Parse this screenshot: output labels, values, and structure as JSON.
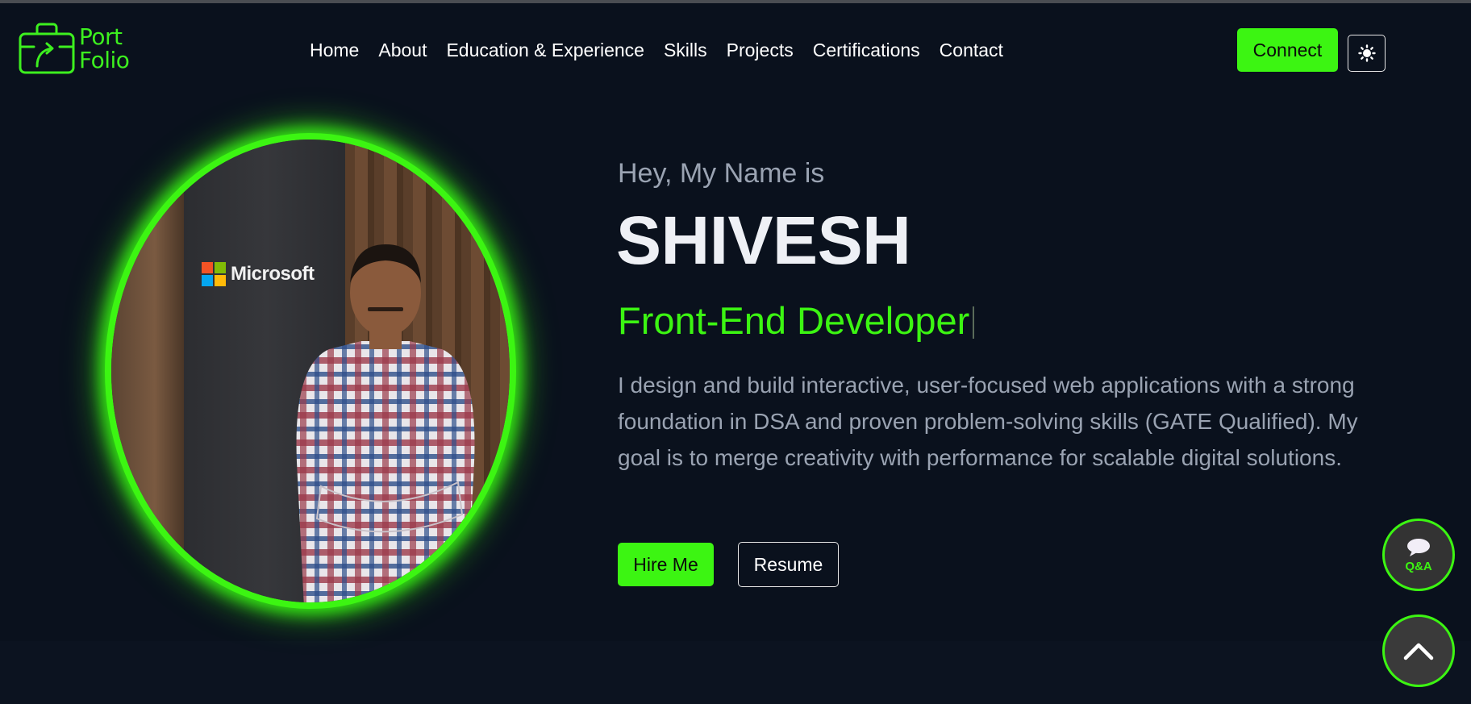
{
  "brand": {
    "logo_line1": "Port",
    "logo_line2": "Folio",
    "accent": "#3cf512"
  },
  "nav": {
    "items": [
      {
        "label": "Home"
      },
      {
        "label": "About"
      },
      {
        "label": "Education & Experience"
      },
      {
        "label": "Skills"
      },
      {
        "label": "Projects"
      },
      {
        "label": "Certifications"
      },
      {
        "label": "Contact"
      }
    ],
    "connect_label": "Connect",
    "theme_icon": "sun-icon"
  },
  "hero": {
    "photo_sign": "Microsoft",
    "greeting": "Hey, My Name is",
    "name": "SHIVESH",
    "role": "Front-End Developer",
    "description": "I design and build interactive, user-focused web applications with a strong foundation in DSA and proven problem-solving skills (GATE Qualified). My goal is to merge creativity with performance for scalable digital solutions.",
    "hire_label": "Hire Me",
    "resume_label": "Resume"
  },
  "floating": {
    "qa_label": "Q&A",
    "qa_icon": "chat-bubble-icon",
    "top_icon": "chevron-up-icon"
  },
  "colors": {
    "background": "#0a111d",
    "accent": "#3cf512",
    "muted_text": "#9aa3b2"
  }
}
